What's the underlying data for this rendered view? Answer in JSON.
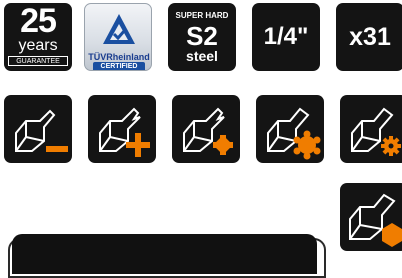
{
  "badges": {
    "guarantee": {
      "number": "25",
      "word": "years",
      "caption": "GUARANTEE"
    },
    "tuv": {
      "brand": "TÜVRheinland",
      "caption": "CERTIFIED"
    },
    "steel": {
      "top": "SUPER HARD",
      "grade": "S2",
      "material": "steel"
    },
    "drive": {
      "label": "1/4\""
    },
    "count": {
      "label": "x31"
    }
  },
  "bit_types": [
    {
      "name": "slotted",
      "symbol": "minus"
    },
    {
      "name": "phillips",
      "symbol": "plus"
    },
    {
      "name": "pozidriv",
      "symbol": "pozidriv"
    },
    {
      "name": "torx",
      "symbol": "torx-star"
    },
    {
      "name": "tamper-torx",
      "symbol": "torx-gear"
    },
    {
      "name": "hex",
      "symbol": "hexagon"
    }
  ],
  "colors": {
    "tile": "#141414",
    "accent": "#f07d00",
    "text": "#ffffff",
    "tuv_blue": "#1a4fa0"
  }
}
